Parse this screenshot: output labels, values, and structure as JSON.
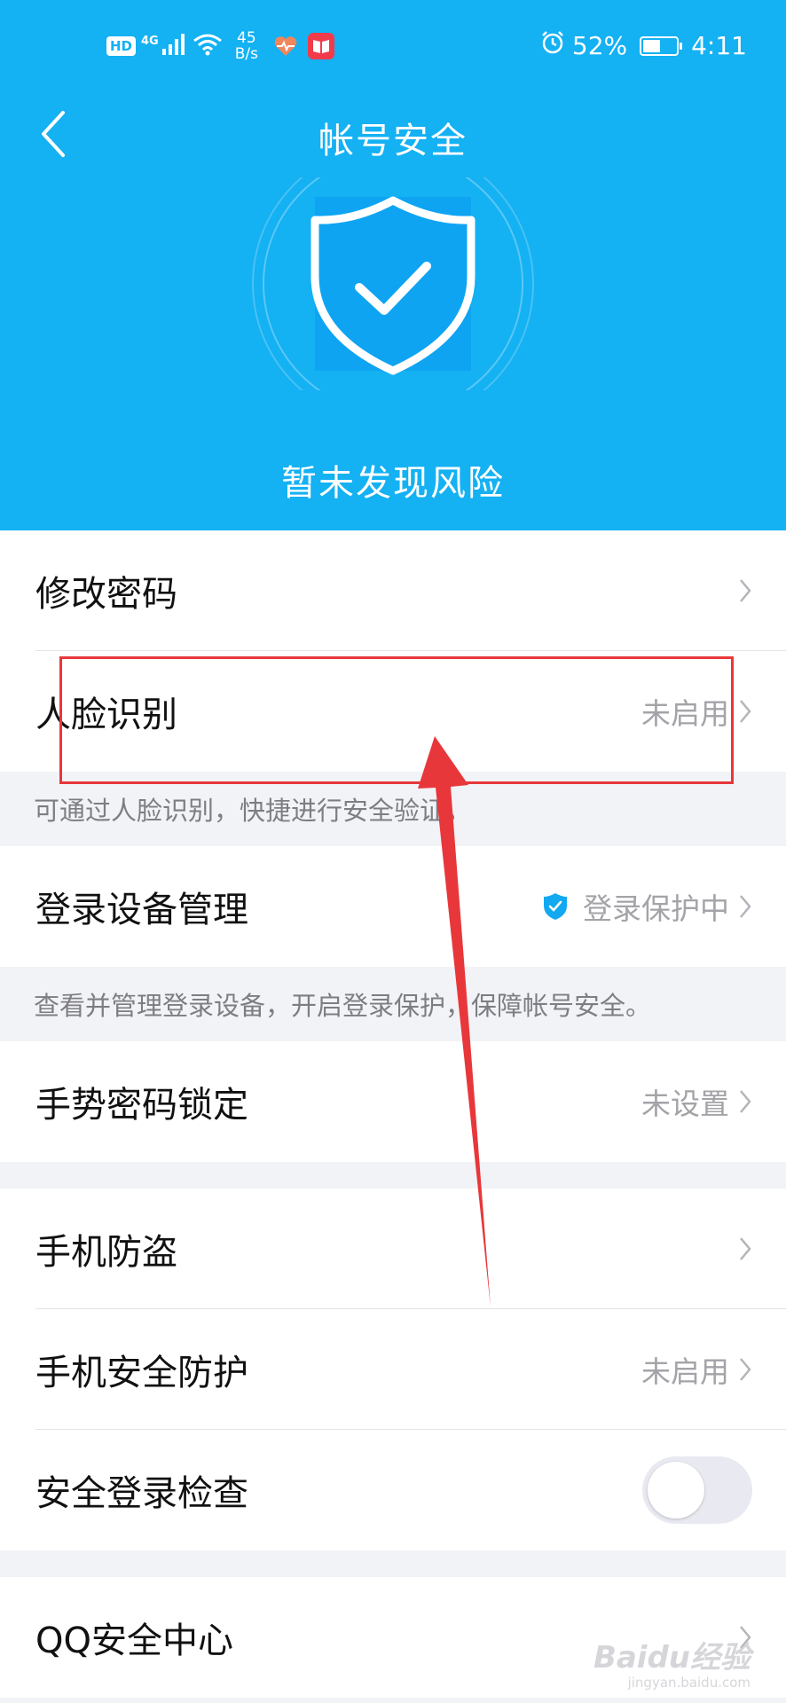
{
  "status_bar": {
    "hd": "HD",
    "network": "4G",
    "speed_value": "45",
    "speed_unit": "B/s",
    "battery": "52%",
    "battery_level": 0.52,
    "time": "4:11"
  },
  "header": {
    "title": "帐号安全",
    "status": "暂未发现风险",
    "background_color": "#14b1f3"
  },
  "items": {
    "change_password": {
      "label": "修改密码"
    },
    "face_recognition": {
      "label": "人脸识别",
      "value": "未启用",
      "note": "可通过人脸识别，快捷进行安全验证。"
    },
    "login_devices": {
      "label": "登录设备管理",
      "value": "登录保护中",
      "note": "查看并管理登录设备，开启登录保护，保障帐号安全。"
    },
    "gesture_lock": {
      "label": "手势密码锁定",
      "value": "未设置"
    },
    "anti_theft": {
      "label": "手机防盗"
    },
    "phone_protection": {
      "label": "手机安全防护",
      "value": "未启用"
    },
    "secure_login_check": {
      "label": "安全登录检查",
      "enabled": false
    },
    "qq_security_center": {
      "label": "QQ安全中心"
    }
  },
  "annotation": {
    "highlight_color": "#e8373b"
  },
  "watermark": {
    "main": "Baidu经验",
    "sub": "jingyan.baidu.com"
  }
}
